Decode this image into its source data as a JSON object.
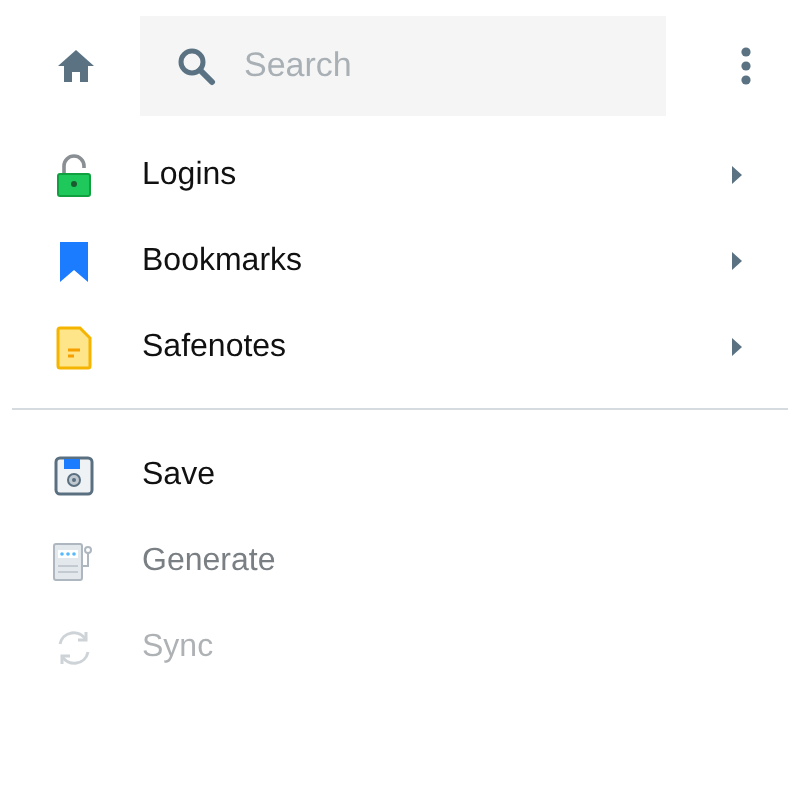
{
  "search": {
    "placeholder": "Search"
  },
  "nav_items": [
    {
      "kind": "lock",
      "label": "Logins"
    },
    {
      "kind": "bookmark",
      "label": "Bookmarks"
    },
    {
      "kind": "note",
      "label": "Safenotes"
    }
  ],
  "actions": [
    {
      "kind": "save",
      "label": "Save",
      "dimmed": false,
      "disabled": false
    },
    {
      "kind": "generate",
      "label": "Generate",
      "dimmed": true,
      "disabled": false
    },
    {
      "kind": "sync",
      "label": "Sync",
      "dimmed": true,
      "disabled": true
    }
  ]
}
